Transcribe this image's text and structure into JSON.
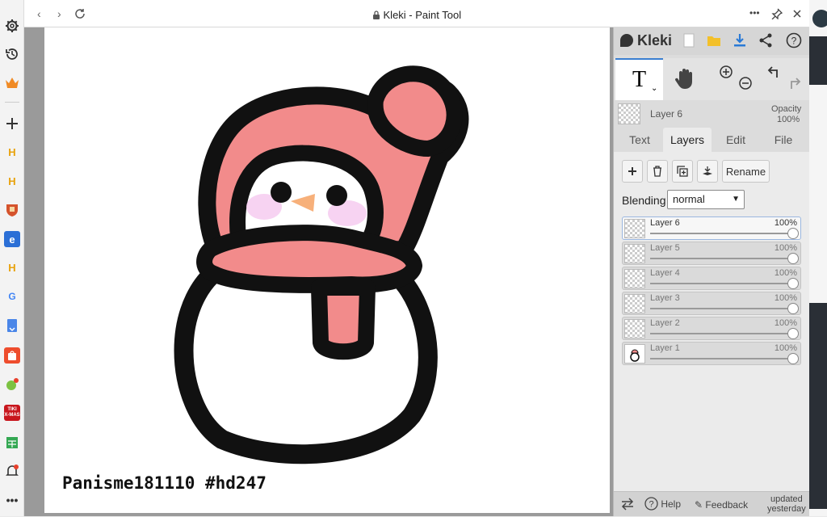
{
  "window": {
    "title": "Kleki - Paint Tool",
    "lock_icon": "lock-icon"
  },
  "browser_sidebar": {
    "icons": [
      "gear-icon",
      "history-icon",
      "crown-icon",
      "plus-icon",
      "h-app-icon",
      "h-app-icon",
      "shield-app-icon",
      "blue-app-icon",
      "h-app-icon",
      "google-icon",
      "docs-icon",
      "shopee-icon",
      "chat-icon",
      "tiki-icon",
      "sheet-icon",
      "bell-icon",
      "more-icon"
    ],
    "tiki_label": "TIKI",
    "tiki_sub": "X-MAS"
  },
  "canvas": {
    "watermark": "Panisme181110 #hd247"
  },
  "panel": {
    "logo_text": "Kleki",
    "current_layer_name": "Layer 6",
    "opacity_label": "Opacity",
    "opacity_value": "100%",
    "tabs": [
      "Text",
      "Layers",
      "Edit",
      "File"
    ],
    "active_tab": "Layers",
    "rename_label": "Rename",
    "blending_label": "Blending",
    "blending_value": "normal",
    "layers": [
      {
        "name": "Layer 6",
        "opacity": "100%",
        "active": true
      },
      {
        "name": "Layer 5",
        "opacity": "100%",
        "active": false
      },
      {
        "name": "Layer 4",
        "opacity": "100%",
        "active": false
      },
      {
        "name": "Layer 3",
        "opacity": "100%",
        "active": false
      },
      {
        "name": "Layer 2",
        "opacity": "100%",
        "active": false
      },
      {
        "name": "Layer 1",
        "opacity": "100%",
        "active": false
      }
    ],
    "bottom": {
      "help": "Help",
      "feedback": "Feedback",
      "updated_line1": "updated",
      "updated_line2": "yesterday"
    }
  },
  "colors": {
    "accent": "#3b7fd1",
    "hat_pink": "#f28b8b",
    "cheek_pink": "#f5c8ef",
    "nose_orange": "#f7b07a"
  }
}
